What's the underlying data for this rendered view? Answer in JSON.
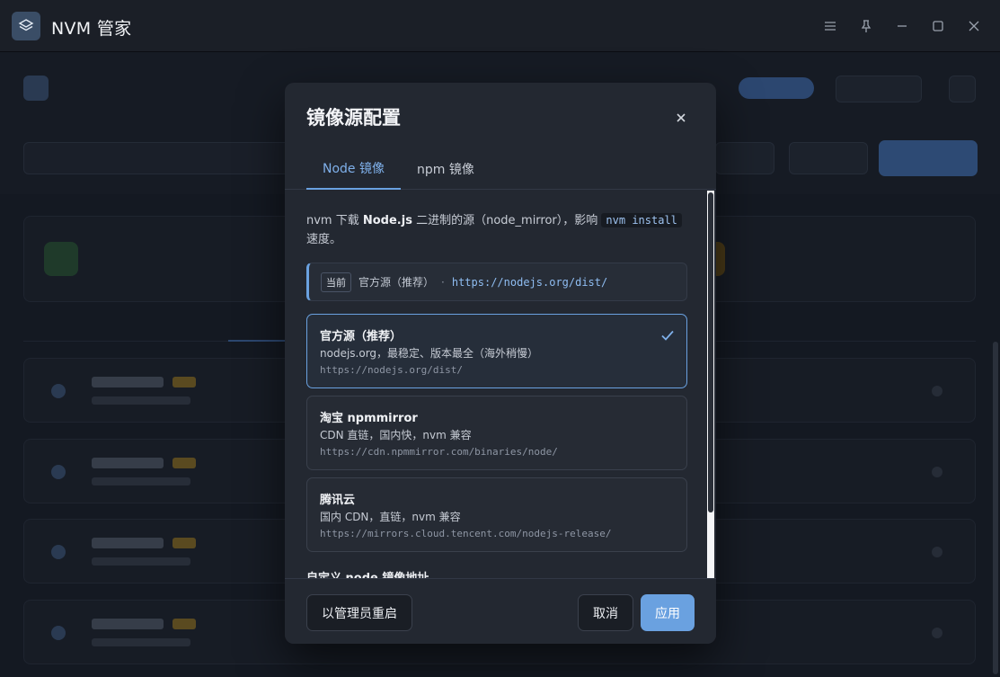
{
  "window": {
    "title": "NVM 管家",
    "menu_icon": "hamburger-icon",
    "pin_icon": "pin-icon",
    "minimize_icon": "minimize-icon",
    "maximize_icon": "maximize-icon",
    "close_icon": "close-icon"
  },
  "modal": {
    "title": "镜像源配置",
    "tabs": [
      {
        "label": "Node 镜像",
        "active": true
      },
      {
        "label": "npm 镜像",
        "active": false
      }
    ],
    "description": {
      "part1": "nvm 下载 ",
      "bold": "Node.js",
      "part2": " 二进制的源（node_mirror），影响 ",
      "code": "nvm install",
      "part3": "速度。"
    },
    "current": {
      "badge": "当前",
      "name": "官方源（推荐）",
      "separator": "·",
      "url": "https://nodejs.org/dist/"
    },
    "mirrors": [
      {
        "name": "官方源（推荐）",
        "desc": "nodejs.org，最稳定、版本最全（海外稍慢）",
        "url": "https://nodejs.org/dist/",
        "selected": true
      },
      {
        "name": "淘宝 npmmirror",
        "desc": "CDN 直链，国内快，nvm 兼容",
        "url": "https://cdn.npmmirror.com/binaries/node/",
        "selected": false
      },
      {
        "name": "腾讯云",
        "desc": "国内 CDN，直链，nvm 兼容",
        "url": "https://mirrors.cloud.tencent.com/nodejs-release/",
        "selected": false
      }
    ],
    "custom_label": "自定义 node 镜像地址",
    "buttons": {
      "restart": "以管理员重启",
      "cancel": "取消",
      "apply": "应用"
    }
  },
  "colors": {
    "accent": "#6aa1e0",
    "modal_bg": "#232831",
    "titlebar_bg": "#1b1f27"
  }
}
